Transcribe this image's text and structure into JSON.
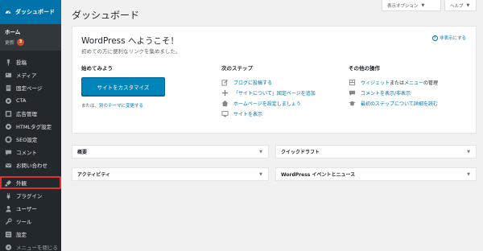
{
  "sidebar": {
    "header": "ダッシュボード",
    "home": "ホーム",
    "update_label": "更新",
    "update_count": "3",
    "items": [
      {
        "label": "投稿",
        "icon": "pin-icon"
      },
      {
        "label": "メディア",
        "icon": "media-icon"
      },
      {
        "label": "固定ページ",
        "icon": "page-icon"
      },
      {
        "label": "CTA",
        "icon": "cta-icon"
      },
      {
        "label": "広告管理",
        "icon": "ad-icon"
      },
      {
        "label": "HTMLタグ設定",
        "icon": "html-icon"
      },
      {
        "label": "SEO設定",
        "icon": "seo-icon"
      },
      {
        "label": "コメント",
        "icon": "comment-icon"
      },
      {
        "label": "お問い合わせ",
        "icon": "mail-icon"
      },
      {
        "label": "外観",
        "icon": "appearance-icon"
      },
      {
        "label": "プラグイン",
        "icon": "plugin-icon"
      },
      {
        "label": "ユーザー",
        "icon": "user-icon"
      },
      {
        "label": "ツール",
        "icon": "tool-icon"
      },
      {
        "label": "設定",
        "icon": "settings-icon"
      },
      {
        "label": "メニューを閉じる",
        "icon": "collapse-icon"
      }
    ]
  },
  "header": {
    "title": "ダッシュボード",
    "screen_options": "表示オプション",
    "help": "ヘルプ"
  },
  "welcome": {
    "title": "WordPress へようこそ！",
    "about": "初めての方に便利なリンクを集めました。",
    "dismiss": "非表示にする",
    "get_started": {
      "heading": "始めてみよう",
      "button": "サイトをカスタマイズ",
      "or_text": "または、",
      "or_link": "別のテーマに変更する"
    },
    "next_steps": {
      "heading": "次のステップ",
      "items": [
        {
          "label": "ブログに投稿する",
          "icon": "edit-icon"
        },
        {
          "label": "「サイトについて」固定ページを追加",
          "icon": "plus-icon"
        },
        {
          "label": "ホームページを設定しましょう",
          "icon": "home-icon"
        },
        {
          "label": "サイトを表示",
          "icon": "view-site-icon"
        }
      ]
    },
    "more_actions": {
      "heading": "その他の操作",
      "items": [
        {
          "pre": "",
          "link1": "ウィジェット",
          "mid": "または",
          "link2": "メニュー",
          "post": "の管理",
          "icon": "widgets-icon"
        },
        {
          "pre": "",
          "link1": "コメントを表示/非表示",
          "mid": "",
          "link2": "",
          "post": "",
          "icon": "comments-icon"
        },
        {
          "pre": "",
          "link1": "最初のステップについて詳細を読む",
          "mid": "",
          "link2": "",
          "post": "",
          "icon": "learn-icon"
        }
      ]
    }
  },
  "boxes": [
    {
      "title": "概要"
    },
    {
      "title": "クイックドラフト"
    },
    {
      "title": "アクティビティ"
    },
    {
      "title": "WordPress イベントとニュース"
    }
  ],
  "colors": {
    "sidebar": "#23282d",
    "accent": "#0073aa",
    "button": "#0085ba",
    "highlight": "#e0302e",
    "badge": "#d54e21"
  }
}
